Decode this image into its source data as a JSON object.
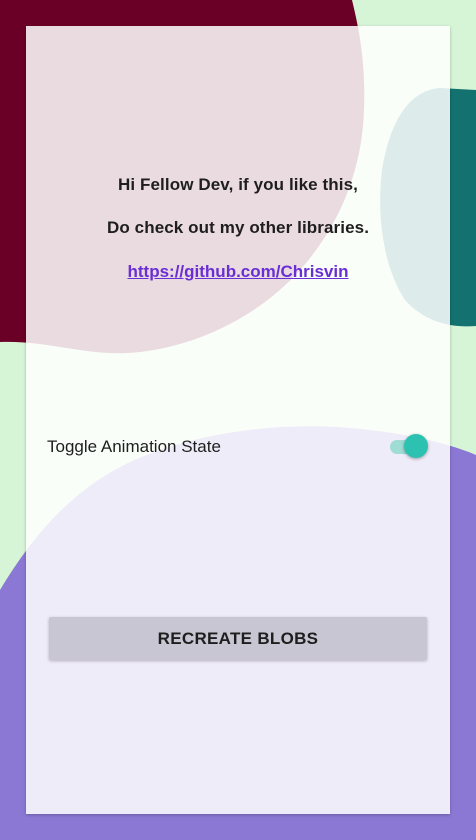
{
  "colors": {
    "background": "#d6f5d6",
    "blob_top_left": "#6b0026",
    "blob_right": "#137170",
    "blob_bottom": "#8b78d4",
    "card": "#ffffff",
    "link": "#6a2fd4",
    "switch_thumb": "#2cc1b1",
    "switch_track": "#9fdcd4",
    "button": "#c7c6d2"
  },
  "info": {
    "line1": "Hi Fellow Dev, if you like this,",
    "line2": "Do check out my other libraries.",
    "link": "https://github.com/Chrisvin"
  },
  "toggle": {
    "label": "Toggle Animation State",
    "checked": true
  },
  "button": {
    "label": "RECREATE BLOBS"
  }
}
